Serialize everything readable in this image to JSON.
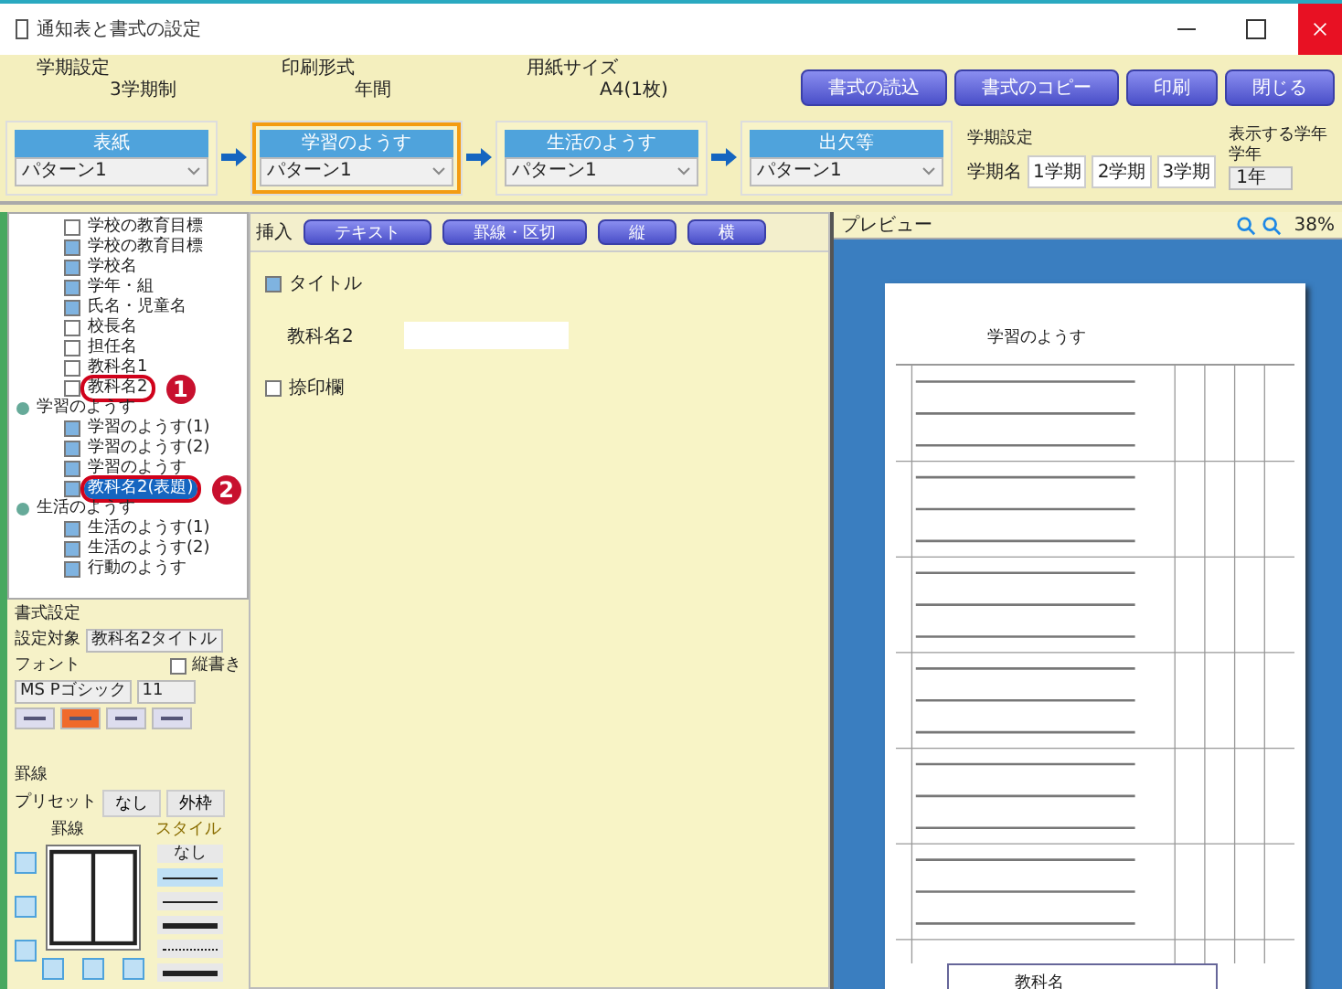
{
  "window": {
    "title": "通知表と書式の設定"
  },
  "settings": [
    {
      "label": "学期設定",
      "value": "3学期制"
    },
    {
      "label": "印刷形式",
      "value": "年間"
    },
    {
      "label": "用紙サイズ",
      "value": "A4(1枚)"
    }
  ],
  "buttons": [
    "書式の読込",
    "書式のコピー",
    "印刷",
    "閉じる"
  ],
  "steps": [
    {
      "label": "表紙",
      "value": "パターン1",
      "selected": false
    },
    {
      "label": "学習のようす",
      "value": "パターン1",
      "selected": true
    },
    {
      "label": "生活のようす",
      "value": "パターン1",
      "selected": false
    },
    {
      "label": "出欠等",
      "value": "パターン1",
      "selected": false
    }
  ],
  "term_names": {
    "label": "学期設定",
    "caption": "学期名",
    "values": [
      "1学期",
      "2学期",
      "3学期"
    ]
  },
  "grade": {
    "label": "表示する学年",
    "caption": "学年",
    "value": "1年"
  },
  "tree": [
    {
      "label": "学校の教育目標",
      "checked": false,
      "selected": false
    },
    {
      "label": "学校の教育目標",
      "checked": true,
      "selected": false
    },
    {
      "label": "学校名",
      "checked": true,
      "selected": false
    },
    {
      "label": "学年・組",
      "checked": true,
      "selected": false
    },
    {
      "label": "氏名・児童名",
      "checked": true,
      "selected": false
    },
    {
      "label": "校長名",
      "checked": false,
      "selected": false
    },
    {
      "label": "担任名",
      "checked": false,
      "selected": false
    },
    {
      "label": "教科名1",
      "checked": false,
      "selected": false
    },
    {
      "label": "教科名2",
      "checked": false,
      "selected": false,
      "callout": "1"
    },
    {
      "label": "学習のようす",
      "expanded": true,
      "children": [
        {
          "label": "学習のようす(1)",
          "checked": true,
          "selected": false
        },
        {
          "label": "学習のようす(2)",
          "checked": true,
          "selected": false
        },
        {
          "label": "学習のようす",
          "checked": true,
          "selected": false
        },
        {
          "label": "教科名2(表題)",
          "checked": true,
          "selected": true,
          "callout": "2"
        }
      ]
    },
    {
      "label": "生活のようす",
      "expanded": true,
      "children": [
        {
          "label": "生活のようす(1)",
          "checked": true,
          "selected": false
        },
        {
          "label": "生活のようす(2)",
          "checked": true,
          "selected": false
        },
        {
          "label": "行動のようす",
          "checked": true,
          "selected": false
        }
      ]
    }
  ],
  "insert": {
    "label": "挿入",
    "buttons": [
      "テキスト",
      "罫線・区切",
      "縦",
      "横"
    ]
  },
  "editor": [
    {
      "kind": "checkbox",
      "label": "タイトル",
      "checked": true
    },
    {
      "kind": "field",
      "label": "教科名2"
    },
    {
      "kind": "checkbox",
      "label": "捺印欄",
      "checked": false
    }
  ],
  "format": {
    "title": "書式設定",
    "target_label": "設定対象",
    "target": "教科名2タイトル",
    "font_label": "フォント",
    "vertical_label": "縦書き",
    "vertical": false,
    "font": "MS Pゴシック",
    "size": "11",
    "align": [
      {
        "selected": false
      },
      {
        "selected": true
      },
      {
        "selected": false
      },
      {
        "selected": false
      }
    ]
  },
  "borders": {
    "title": "罫線",
    "preset_label": "プリセット",
    "presets": [
      "なし",
      "外枠"
    ],
    "border_label": "罫線",
    "style_label": "スタイル",
    "styles": [
      {
        "kind": "text",
        "label": "なし",
        "selected": false
      },
      {
        "kind": "line",
        "selected": true
      },
      {
        "kind": "line",
        "selected": false
      },
      {
        "kind": "thick",
        "selected": false
      },
      {
        "kind": "dotted",
        "selected": false
      },
      {
        "kind": "thick",
        "selected": false
      }
    ]
  },
  "preview": {
    "title": "プレビュー",
    "zoom": "38%",
    "page_heading": "学習のようす",
    "page_footer": "教科名"
  }
}
